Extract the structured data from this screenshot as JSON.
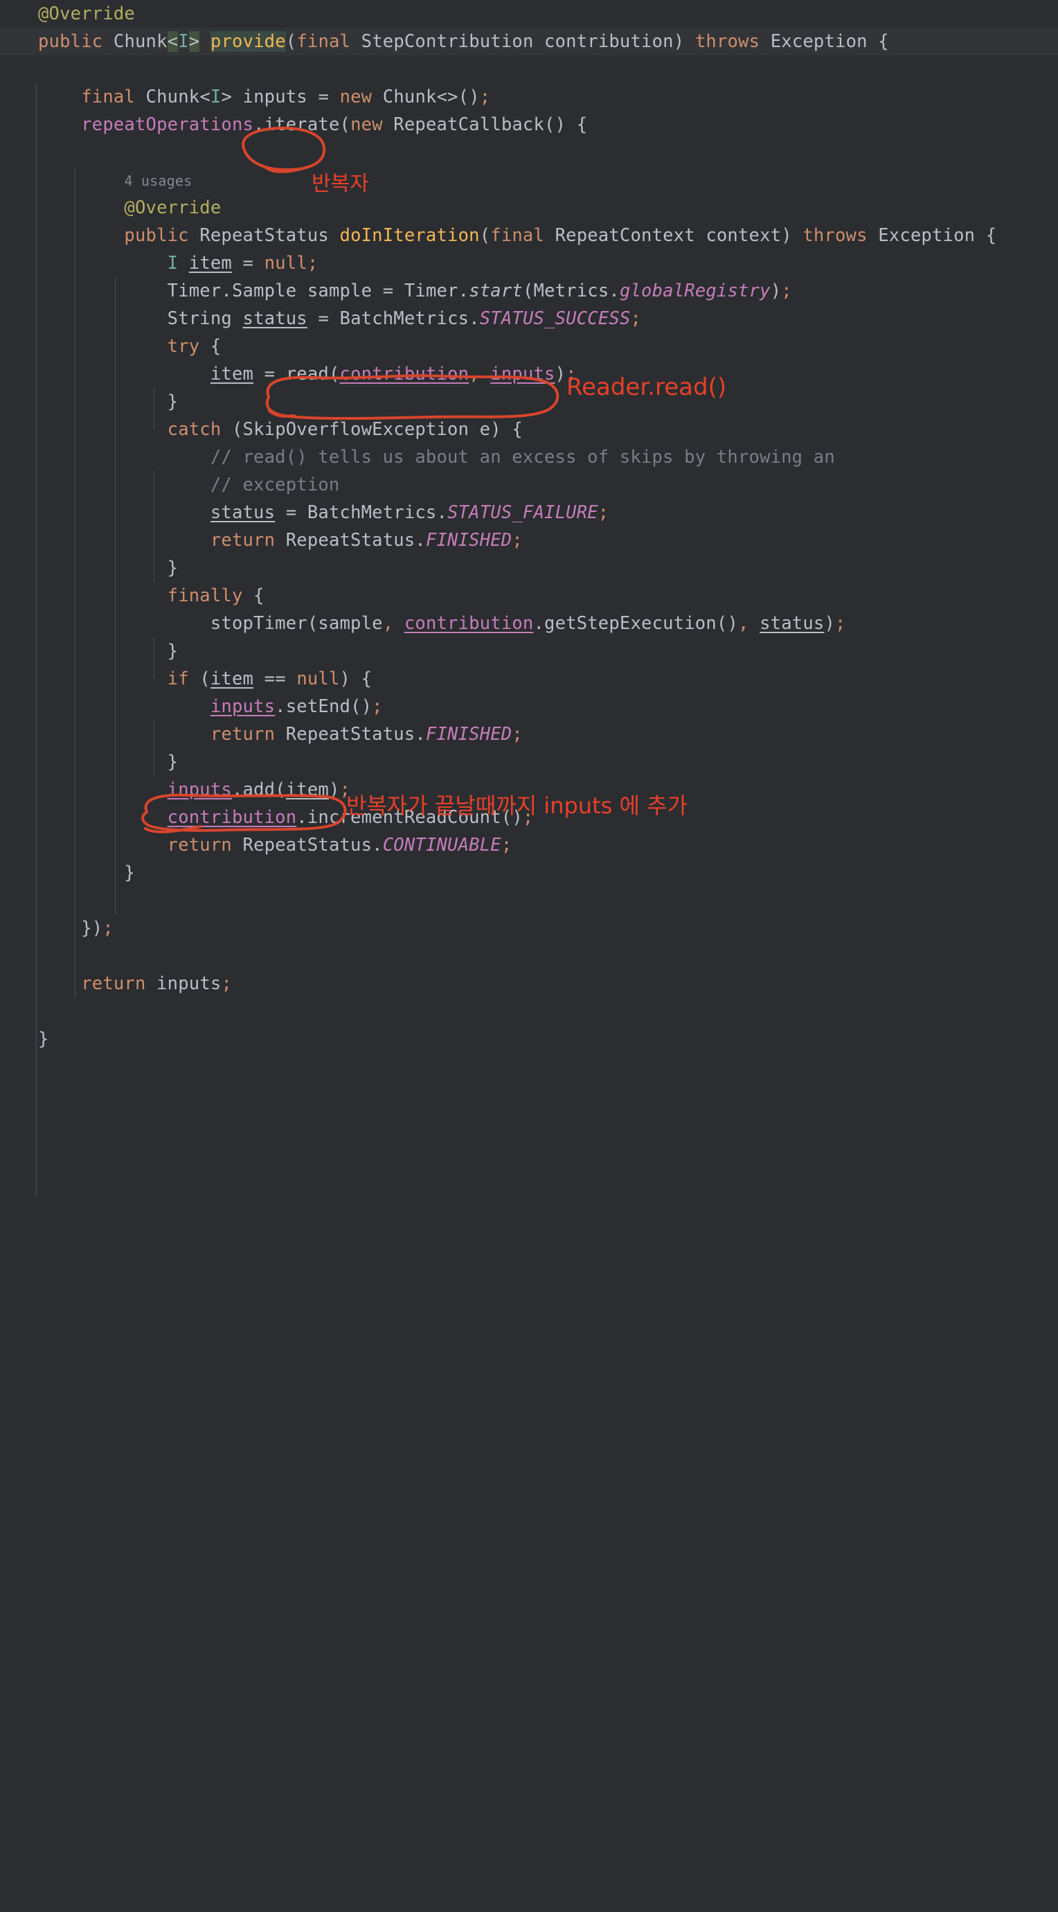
{
  "editor": {
    "background": "#2b2d30",
    "current_line_background": "#323438",
    "annotation_color": "#e8402a",
    "usages_hint": "4 usages"
  },
  "code_lines": [
    {
      "id": "l1",
      "indent": 0,
      "text": "@Override"
    },
    {
      "id": "l2",
      "indent": 0,
      "text": "public Chunk<I> provide(final StepContribution contribution) throws Exception {",
      "highlighted": true
    },
    {
      "id": "l3",
      "indent": 0,
      "text": ""
    },
    {
      "id": "l4",
      "indent": 1,
      "text": "final Chunk<I> inputs = new Chunk<>();"
    },
    {
      "id": "l5",
      "indent": 1,
      "text": "repeatOperations.iterate(new RepeatCallback() {"
    },
    {
      "id": "l6",
      "indent": 2,
      "text": ""
    },
    {
      "id": "l7",
      "indent": 2,
      "text": "4 usages"
    },
    {
      "id": "l8",
      "indent": 2,
      "text": "@Override"
    },
    {
      "id": "l9",
      "indent": 2,
      "text": "public RepeatStatus doInIteration(final RepeatContext context) throws Exception {"
    },
    {
      "id": "l10",
      "indent": 3,
      "text": "I item = null;"
    },
    {
      "id": "l11",
      "indent": 3,
      "text": "Timer.Sample sample = Timer.start(Metrics.globalRegistry);"
    },
    {
      "id": "l12",
      "indent": 3,
      "text": "String status = BatchMetrics.STATUS_SUCCESS;"
    },
    {
      "id": "l13",
      "indent": 3,
      "text": "try {"
    },
    {
      "id": "l14",
      "indent": 4,
      "text": "item = read(contribution, inputs);"
    },
    {
      "id": "l15",
      "indent": 3,
      "text": "}"
    },
    {
      "id": "l16",
      "indent": 3,
      "text": "catch (SkipOverflowException e) {"
    },
    {
      "id": "l17",
      "indent": 4,
      "text": "// read() tells us about an excess of skips by throwing an"
    },
    {
      "id": "l18",
      "indent": 4,
      "text": "// exception"
    },
    {
      "id": "l19",
      "indent": 4,
      "text": "status = BatchMetrics.STATUS_FAILURE;"
    },
    {
      "id": "l20",
      "indent": 4,
      "text": "return RepeatStatus.FINISHED;"
    },
    {
      "id": "l21",
      "indent": 3,
      "text": "}"
    },
    {
      "id": "l22",
      "indent": 3,
      "text": "finally {"
    },
    {
      "id": "l23",
      "indent": 4,
      "text": "stopTimer(sample, contribution.getStepExecution(), status);"
    },
    {
      "id": "l24",
      "indent": 3,
      "text": "}"
    },
    {
      "id": "l25",
      "indent": 3,
      "text": "if (item == null) {"
    },
    {
      "id": "l26",
      "indent": 4,
      "text": "inputs.setEnd();"
    },
    {
      "id": "l27",
      "indent": 4,
      "text": "return RepeatStatus.FINISHED;"
    },
    {
      "id": "l28",
      "indent": 3,
      "text": "}"
    },
    {
      "id": "l29",
      "indent": 3,
      "text": "inputs.add(item);"
    },
    {
      "id": "l30",
      "indent": 3,
      "text": "contribution.incrementReadCount();"
    },
    {
      "id": "l31",
      "indent": 3,
      "text": "return RepeatStatus.CONTINUABLE;"
    },
    {
      "id": "l32",
      "indent": 2,
      "text": "}"
    },
    {
      "id": "l33",
      "indent": 2,
      "text": ""
    },
    {
      "id": "l34",
      "indent": 1,
      "text": "});"
    },
    {
      "id": "l35",
      "indent": 0,
      "text": ""
    },
    {
      "id": "l36",
      "indent": 1,
      "text": "return inputs;"
    },
    {
      "id": "l37",
      "indent": 0,
      "text": ""
    },
    {
      "id": "l38",
      "indent": 0,
      "text": "}"
    }
  ],
  "annotations": [
    {
      "id": "a1",
      "label": "반복자",
      "kind": "handwritten-note"
    },
    {
      "id": "a2",
      "label": "Reader.read()",
      "kind": "handwritten-note"
    },
    {
      "id": "a3",
      "label": "반복자가 끝날때까지 inputs 에 추가",
      "kind": "handwritten-note"
    }
  ]
}
